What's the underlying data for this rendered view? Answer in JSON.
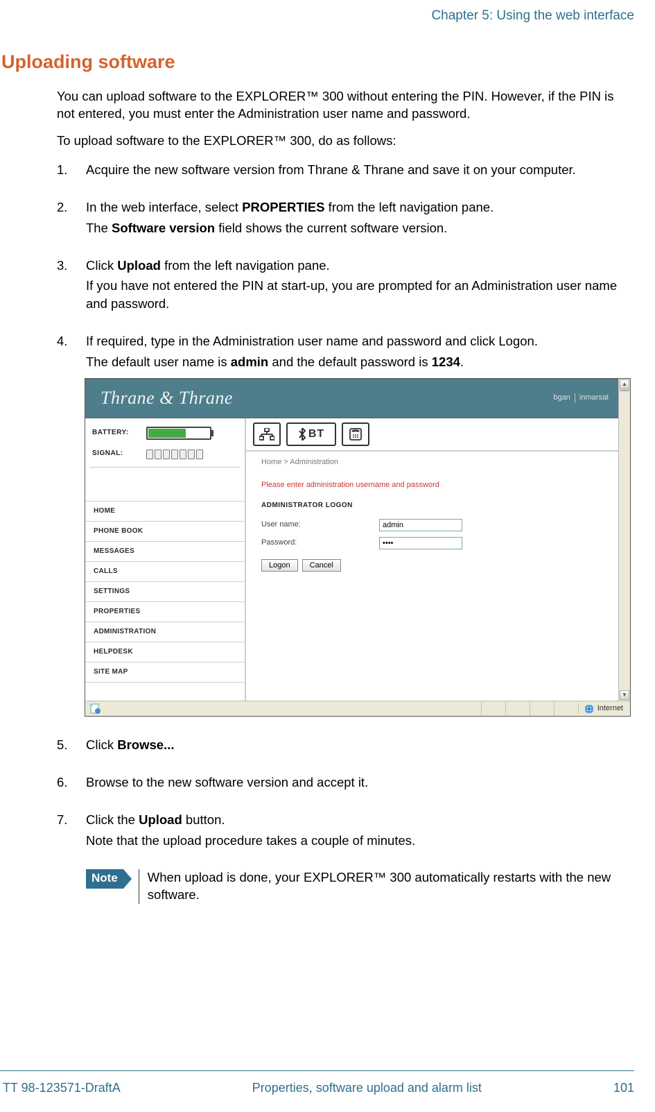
{
  "chapter_header": "Chapter 5: Using the web interface",
  "section_title": "Uploading software",
  "intro1": "You can upload software to the EXPLORER™ 300 without entering the PIN. However, if the PIN is not entered, you must enter the Administration user name and password.",
  "intro2": "To upload software to the EXPLORER™ 300, do as follows:",
  "steps": {
    "s1": "Acquire the new software version from Thrane & Thrane and save it on your computer.",
    "s2a": "In the web interface, select ",
    "s2b": "PROPERTIES",
    "s2c": " from the left navigation pane.",
    "s2d_a": "The ",
    "s2d_b": "Software version",
    "s2d_c": " field shows the current software version.",
    "s3a": "Click ",
    "s3b": "Upload",
    "s3c": " from the left navigation pane.",
    "s3d": "If you have not entered the PIN at start-up, you are prompted for an Administration user name and password.",
    "s4a": "If required, type in the Administration user name and password and click Logon.",
    "s4b_a": "The default user name is ",
    "s4b_b": "admin",
    "s4b_c": " and the default password is ",
    "s4b_d": "1234",
    "s4b_e": ".",
    "s5a": "Click ",
    "s5b": "Browse...",
    "s6": "Browse to the new software version and accept it.",
    "s7a": "Click the ",
    "s7b": "Upload",
    "s7c": " button.",
    "s7d": "Note that the upload procedure takes a couple of minutes."
  },
  "note": {
    "tag": "Note",
    "text": "When upload is done, your EXPLORER™ 300 automatically restarts with the new software."
  },
  "screenshot": {
    "brand": "Thrane & Thrane",
    "bgan": "bgan",
    "inmarsat": "inmarsat",
    "battery_label": "BATTERY:",
    "signal_label": "SIGNAL:",
    "nav": [
      "HOME",
      "PHONE BOOK",
      "MESSAGES",
      "CALLS",
      "SETTINGS",
      "PROPERTIES",
      "ADMINISTRATION",
      "HELPDESK",
      "SITE MAP"
    ],
    "bt_icon_text": "BT",
    "breadcrumb": "Home > Administration",
    "alert": "Please enter administration username and password",
    "form_title": "ADMINISTRATOR LOGON",
    "user_label": "User name:",
    "user_value": "admin",
    "pass_label": "Password:",
    "pass_value": "••••",
    "logon_btn": "Logon",
    "cancel_btn": "Cancel",
    "status_net": "Internet"
  },
  "footer": {
    "left": "TT 98-123571-DraftA",
    "center": "Properties, software upload and alarm list",
    "right": "101"
  }
}
